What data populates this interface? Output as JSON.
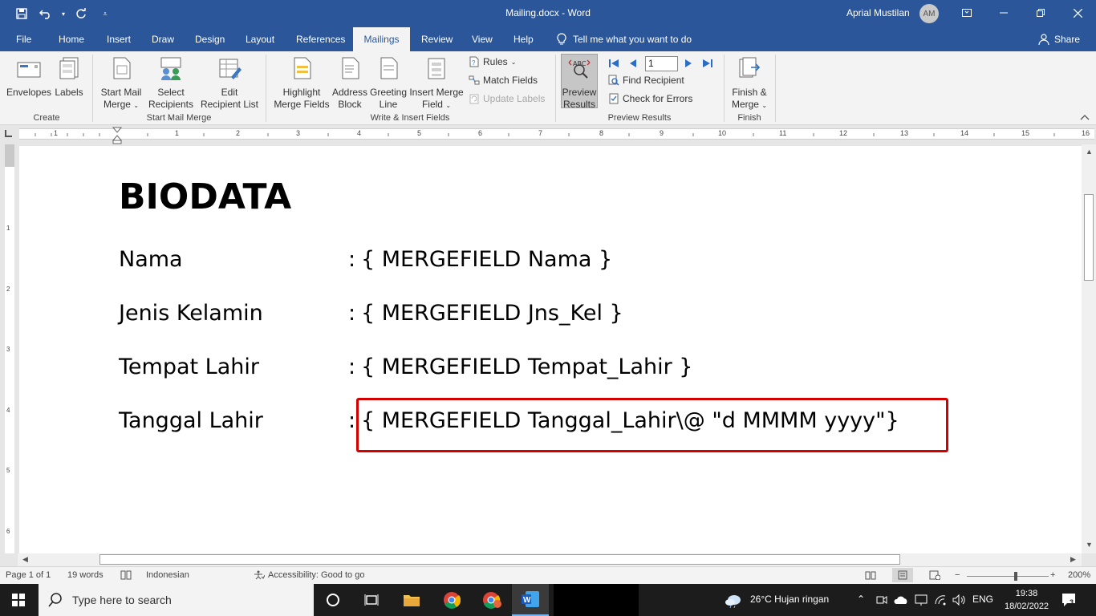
{
  "window": {
    "title": "Mailing.docx  -  Word",
    "user_name": "Aprial Mustilan",
    "user_initials": "AM"
  },
  "tabs": [
    "File",
    "Home",
    "Insert",
    "Draw",
    "Design",
    "Layout",
    "References",
    "Mailings",
    "Review",
    "View",
    "Help"
  ],
  "active_tab": "Mailings",
  "tell_me": "Tell me what you want to do",
  "share": "Share",
  "ribbon": {
    "create": {
      "label": "Create",
      "envelopes": "Envelopes",
      "labels": "Labels"
    },
    "start_mail_merge": {
      "label": "Start Mail Merge",
      "start_line1": "Start Mail",
      "start_line2": "Merge",
      "select_line1": "Select",
      "select_line2": "Recipients",
      "edit_line1": "Edit",
      "edit_line2": "Recipient List"
    },
    "write_insert": {
      "label": "Write & Insert Fields",
      "highlight_line1": "Highlight",
      "highlight_line2": "Merge Fields",
      "address_line1": "Address",
      "address_line2": "Block",
      "greeting_line1": "Greeting",
      "greeting_line2": "Line",
      "insert_line1": "Insert Merge",
      "insert_line2": "Field",
      "rules": "Rules",
      "match_fields": "Match Fields",
      "update_labels": "Update Labels"
    },
    "preview_results": {
      "label": "Preview Results",
      "preview_line1": "Preview",
      "preview_line2": "Results",
      "record": "1",
      "find_recipient": "Find Recipient",
      "check_errors": "Check for Errors"
    },
    "finish": {
      "label": "Finish",
      "finish_line1": "Finish &",
      "finish_line2": "Merge"
    }
  },
  "ruler": {
    "h_numbers": [
      "1",
      "1",
      "2",
      "3",
      "4",
      "5",
      "6",
      "7",
      "8",
      "9",
      "10",
      "11",
      "12",
      "13",
      "14",
      "15",
      "16"
    ],
    "v_numbers": [
      "1",
      "2",
      "3",
      "4",
      "5",
      "6"
    ]
  },
  "document": {
    "heading": "BIODATA",
    "rows": [
      {
        "label": "Nama",
        "colon": ":",
        "field": "{ MERGEFIELD Nama }"
      },
      {
        "label": "Jenis Kelamin",
        "colon": ":",
        "field": "{ MERGEFIELD Jns_Kel }"
      },
      {
        "label": "Tempat Lahir",
        "colon": ":",
        "field": "{ MERGEFIELD Tempat_Lahir }"
      },
      {
        "label": "Tanggal Lahir",
        "colon": ":",
        "field": "{ MERGEFIELD Tanggal_Lahir\\@ \"d MMMM yyyy\"}"
      }
    ]
  },
  "status": {
    "page": "Page 1 of 1",
    "words": "19 words",
    "language": "Indonesian",
    "accessibility": "Accessibility: Good to go",
    "zoom": "200%"
  },
  "taskbar": {
    "search_placeholder": "Type here to search",
    "weather": "26°C  Hujan ringan",
    "lang": "ENG",
    "time": "19:38",
    "date": "18/02/2022",
    "notif_count": "3"
  }
}
